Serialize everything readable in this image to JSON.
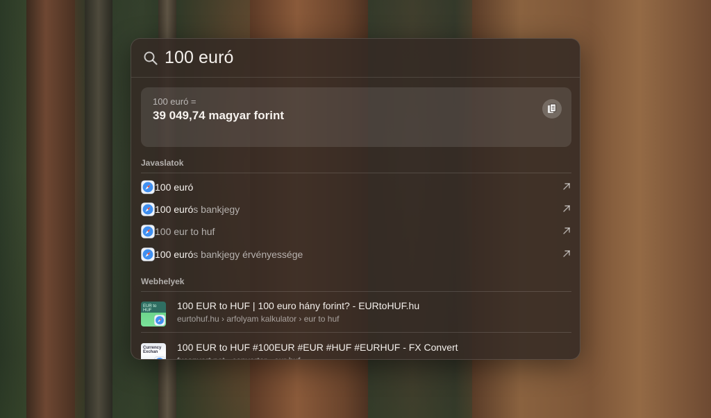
{
  "search": {
    "query": "100 euró"
  },
  "conversion": {
    "label": "100 euró =",
    "result": "39 049,74 magyar forint",
    "copy_icon": "copy-icon"
  },
  "suggestions": {
    "title": "Javaslatok",
    "items": [
      {
        "bold": "100 euró",
        "rest": ""
      },
      {
        "bold": "100 euró",
        "rest": "s bankjegy"
      },
      {
        "bold": "",
        "rest": "100 eur to huf"
      },
      {
        "bold": "100 euró",
        "rest": "s bankjegy érvényessége"
      }
    ]
  },
  "websites": {
    "title": "Webhelyek",
    "items": [
      {
        "title": "100 EUR to HUF | 100 euro hány forint? - EURtoHUF.hu",
        "url": "eurtohuf.hu › arfolyam kalkulator › eur to huf",
        "thumb_text": "EUR to HUF"
      },
      {
        "title": "100 EUR to HUF #100EUR #EUR #HUF #EURHUF - FX Convert",
        "url": "fxconvert.net › converter › eur huf",
        "thumb_text": "Currency Exchan"
      }
    ]
  },
  "colors": {
    "panel_bg": "#342a24",
    "accent_safari": "#3f8ff0"
  }
}
